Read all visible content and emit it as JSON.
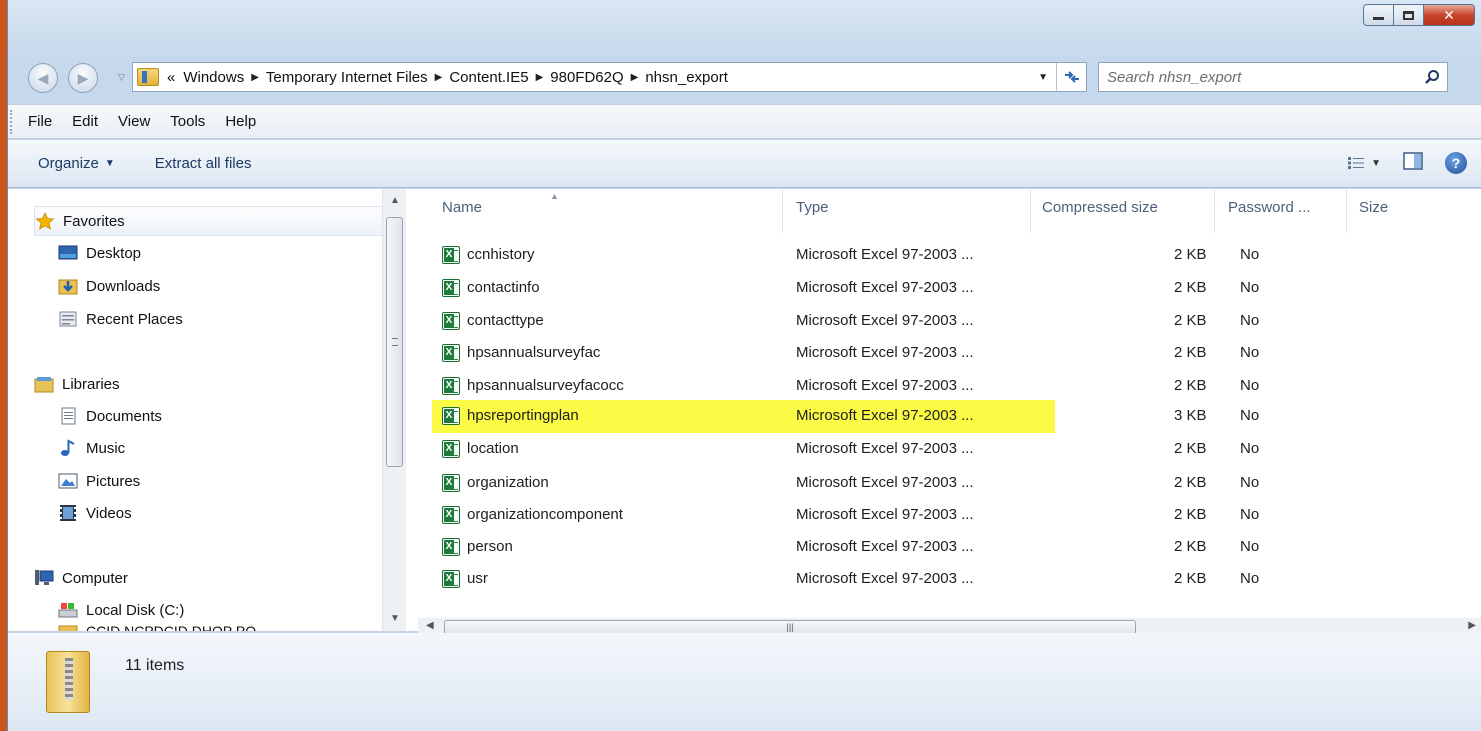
{
  "address": {
    "overflow": "«",
    "crumbs": [
      "Windows",
      "Temporary Internet Files",
      "Content.IE5",
      "980FD62Q",
      "nhsn_export"
    ]
  },
  "search": {
    "placeholder": "Search nhsn_export"
  },
  "menu": [
    "File",
    "Edit",
    "View",
    "Tools",
    "Help"
  ],
  "toolbar": {
    "organize": "Organize",
    "extract": "Extract all files"
  },
  "nav": {
    "favorites": "Favorites",
    "desktop": "Desktop",
    "downloads": "Downloads",
    "recent": "Recent Places",
    "libraries": "Libraries",
    "documents": "Documents",
    "music": "Music",
    "pictures": "Pictures",
    "videos": "Videos",
    "computer": "Computer",
    "local_disk": "Local Disk (C:)",
    "partial": "CCID NCPDCID DHOP PO"
  },
  "columns": {
    "name": "Name",
    "type": "Type",
    "compressed": "Compressed size",
    "password": "Password ...",
    "size": "Size"
  },
  "files": [
    {
      "name": "ccnhistory",
      "type": "Microsoft Excel 97-2003 ...",
      "compressed": "2 KB",
      "password": "No"
    },
    {
      "name": "contactinfo",
      "type": "Microsoft Excel 97-2003 ...",
      "compressed": "2 KB",
      "password": "No"
    },
    {
      "name": "contacttype",
      "type": "Microsoft Excel 97-2003 ...",
      "compressed": "2 KB",
      "password": "No"
    },
    {
      "name": "hpsannualsurveyfac",
      "type": "Microsoft Excel 97-2003 ...",
      "compressed": "2 KB",
      "password": "No"
    },
    {
      "name": "hpsannualsurveyfacocc",
      "type": "Microsoft Excel 97-2003 ...",
      "compressed": "2 KB",
      "password": "No"
    },
    {
      "name": "hpsreportingplan",
      "type": "Microsoft Excel 97-2003 ...",
      "compressed": "3 KB",
      "password": "No",
      "highlighted": true
    },
    {
      "name": "location",
      "type": "Microsoft Excel 97-2003 ...",
      "compressed": "2 KB",
      "password": "No"
    },
    {
      "name": "organization",
      "type": "Microsoft Excel 97-2003 ...",
      "compressed": "2 KB",
      "password": "No"
    },
    {
      "name": "organizationcomponent",
      "type": "Microsoft Excel 97-2003 ...",
      "compressed": "2 KB",
      "password": "No"
    },
    {
      "name": "person",
      "type": "Microsoft Excel 97-2003 ...",
      "compressed": "2 KB",
      "password": "No"
    },
    {
      "name": "usr",
      "type": "Microsoft Excel 97-2003 ...",
      "compressed": "2 KB",
      "password": "No"
    }
  ],
  "status": {
    "items": "11 items"
  },
  "colors": {
    "highlight": "#fbfb46",
    "link_blue": "#1d3a63",
    "header_text": "#4c607a"
  }
}
